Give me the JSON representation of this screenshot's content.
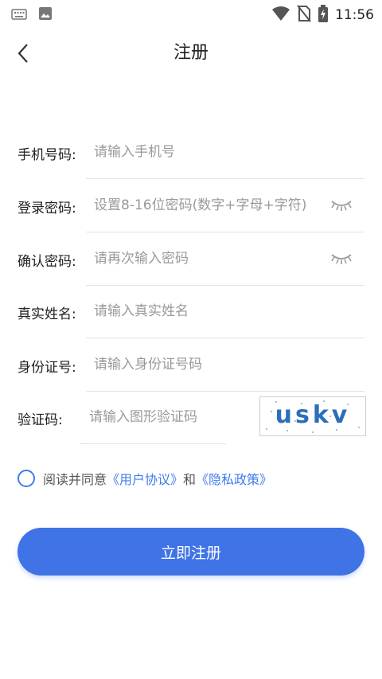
{
  "status_bar": {
    "time": "11:56",
    "icons": [
      "keyboard-icon",
      "image-icon",
      "wifi-icon",
      "no-sim-icon",
      "battery-charging-icon"
    ]
  },
  "header": {
    "title": "注册",
    "back_icon": "chevron-left-icon"
  },
  "form": {
    "phone": {
      "label": "手机号码:",
      "placeholder": "请输入手机号"
    },
    "password": {
      "label": "登录密码:",
      "placeholder": "设置8-16位密码(数字+字母+字符)",
      "toggle_icon": "eye-closed-icon"
    },
    "confirm_password": {
      "label": "确认密码:",
      "placeholder": "请再次输入密码",
      "toggle_icon": "eye-closed-icon"
    },
    "real_name": {
      "label": "真实姓名:",
      "placeholder": "请输入真实姓名"
    },
    "id_number": {
      "label": "身份证号:",
      "placeholder": "请输入身份证号码"
    },
    "captcha": {
      "label": "验证码:",
      "placeholder": "请输入图形验证码",
      "image_text": "uskv"
    }
  },
  "agreement": {
    "prefix": "阅读并同意",
    "user_agreement": "《用户协议》",
    "conjunction": "和",
    "privacy_policy": "《隐私政策》",
    "checked": false
  },
  "submit_label": "立即注册",
  "colors": {
    "accent": "#3f73e6",
    "link": "#3f7bf0",
    "captcha_text": "#2a6fb8"
  }
}
